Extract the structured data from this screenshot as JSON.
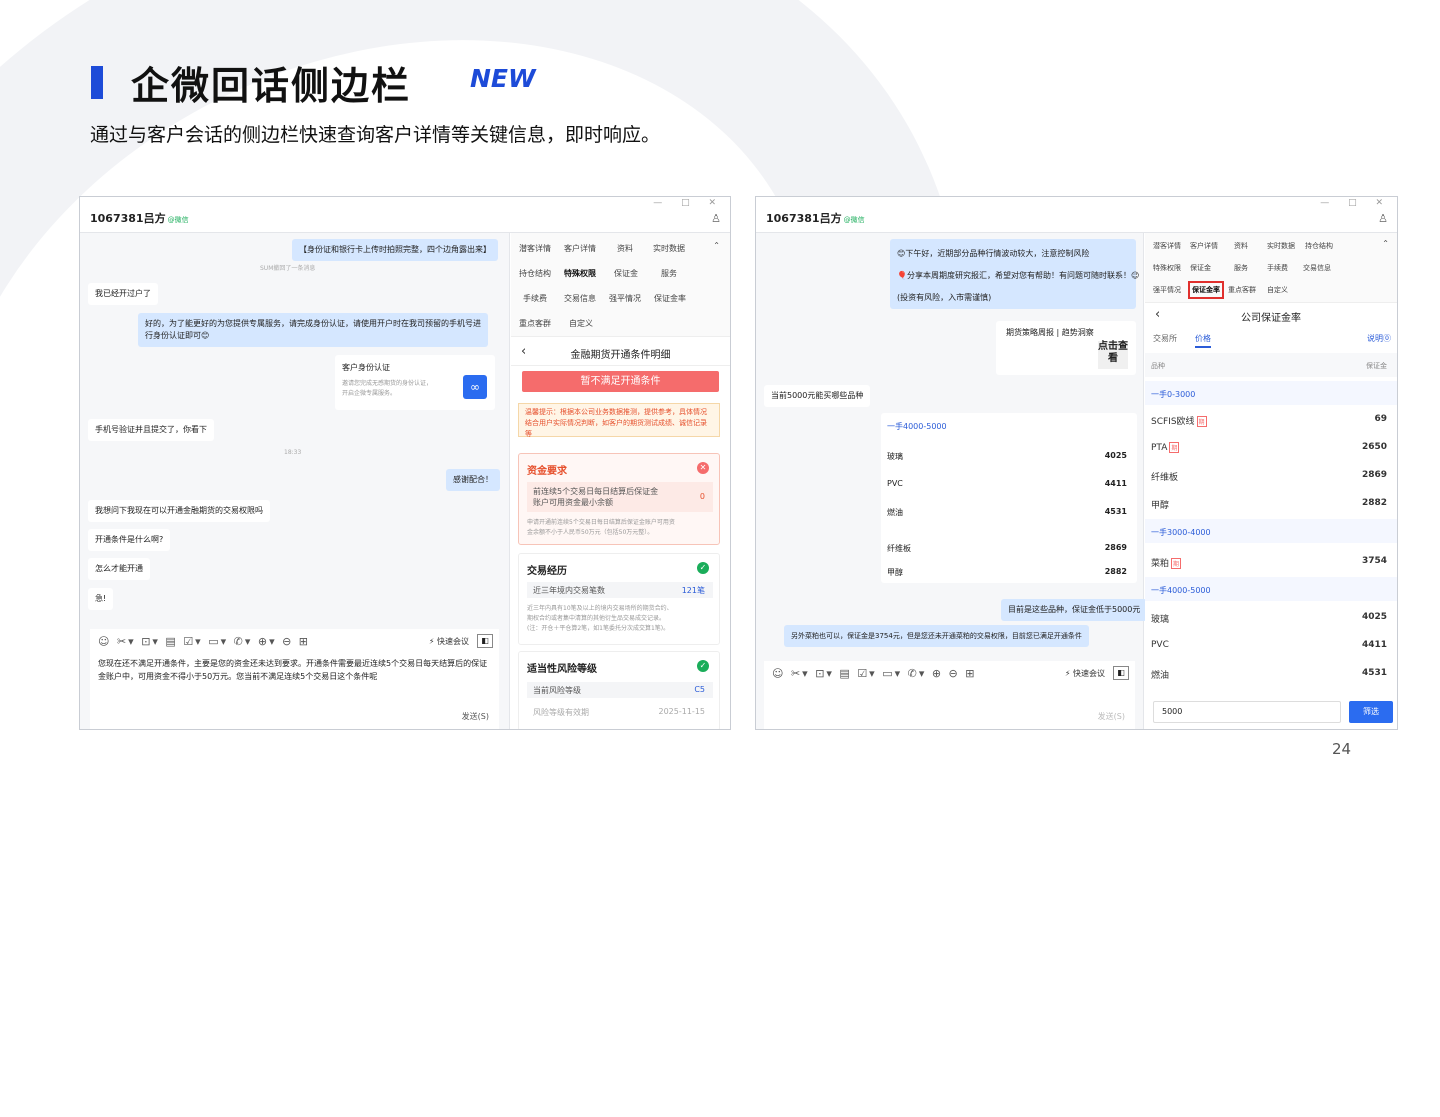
{
  "page": {
    "title": "企微回话侧边栏",
    "new_badge": "NEW",
    "subtitle": "通过与客户会话的侧边栏快速查询客户详情等关键信息，即时响应。",
    "page_number": "24"
  },
  "colors": {
    "accent": "#1d4bd8",
    "danger": "#f56c6c",
    "ok": "#1aad5a",
    "bubble": "#d5e7ff"
  },
  "window": {
    "contact_name": "1067381吕方",
    "wechat_tag": "@微信",
    "controls": "—  □  ✕",
    "user_icon": "add-user-icon"
  },
  "shot1": {
    "messages": [
      {
        "text": "【身份证和银行卡上传时拍照完整，四个边角露出来】"
      },
      {
        "text": "SUM撤回了一条消息"
      },
      {
        "text": "我已经开过户了"
      },
      {
        "text": "好的，为了能更好的为您提供专属服务，请完成身份认证，请使用开户时在我司预留的手机号进"
      },
      {
        "text": "行身份认证即可😊"
      },
      {
        "text": "手机号验证并且提交了，你看下"
      },
      {
        "text": "18:33"
      },
      {
        "text": "感谢配合！"
      },
      {
        "text": "我想问下我现在可以开通金融期货的交易权限吗"
      },
      {
        "text": "开通条件是什么啊?"
      },
      {
        "text": "怎么才能开通"
      },
      {
        "text": "急!"
      }
    ],
    "card": {
      "title": "客户身份认证",
      "desc1": "邀请您完成无感期货的身份认证，",
      "desc2": "开启企微专属服务。"
    },
    "toolbar": {
      "icons": "☺ ✂▾ ⊡▾ ▤ ☑▾ ▭▾ ✆▾ ⊕▾ ⊖ ⊞",
      "quick_meeting": "快速会议"
    },
    "draft": "您现在还不满足开通条件，主要是您的资金还未达到要求。开通条件需要最近连续5个交易日每天结算后的保证金账户中，可用资金不得小于50万元。您当前不满足连续5个交易日这个条件呢",
    "send_label": "发送(S)",
    "tabs": [
      {
        "label": "潜客详情"
      },
      {
        "label": "客户详情"
      },
      {
        "label": "资料"
      },
      {
        "label": "实时数据"
      },
      {
        "label": "持仓结构"
      },
      {
        "label": "特殊权限"
      },
      {
        "label": "保证金"
      },
      {
        "label": "服务"
      },
      {
        "label": "手续费"
      },
      {
        "label": "交易信息"
      },
      {
        "label": "强平情况"
      },
      {
        "label": "保证金率"
      },
      {
        "label": "重点客群"
      },
      {
        "label": "自定义"
      }
    ],
    "panel_title": "金融期货开通条件明细",
    "status_button": "暂不满足开通条件",
    "warm_tip": "温馨提示：根据本公司业务数据推测，提供参考，具体情况结合用户实际情况判断，如客户的期货测试成绩、诚信记录等",
    "sections": {
      "capital": {
        "title": "资金要求",
        "row_label1": "前连续5个交易日每日结算后保证金",
        "row_label2": "账户可用资金最小余额",
        "row_value": "0",
        "desc1": "申请开通前连续5个交易日每日结算后保证金账户可用资",
        "desc2": "金余额不小于人民币50万元（包括50万元整）。"
      },
      "experience": {
        "title": "交易经历",
        "row_label": "近三年境内交易笔数",
        "row_value": "121笔",
        "desc1": "近三年内具有10笔及以上的境内交易场所的期货合约、",
        "desc2": "期权合约或者集中清算的其他衍生品交易成交记录。",
        "desc3": "(注：开仓＋平仓算2笔，如1笔委托分次成交算1笔)。"
      },
      "risk": {
        "title": "适当性风险等级",
        "row1_label": "当前风险等级",
        "row1_value": "C5",
        "row2_label": "风险等级有效期",
        "row2_value": "2025-11-15"
      }
    }
  },
  "shot2": {
    "messages": [
      {
        "text": "😊下午好，近期部分品种行情波动较大，注意控制风险"
      },
      {
        "text": "🎈分享本周期度研究报汇，希望对您有帮助！有问题可随时联系！😉"
      },
      {
        "text": "(投资有风险，入市需谨慎)"
      },
      {
        "text": "期货策略周报 | 趋势洞察"
      },
      {
        "text": "点击查看"
      },
      {
        "text": "当前5000元能买哪些品种"
      },
      {
        "text": "目前是这些品种，保证金低于5000元"
      },
      {
        "text": "另外菜粕也可以，保证金是3754元，但是您还未开通菜粕的交易权限，目前您已满足开通条件"
      }
    ],
    "chat_card": {
      "group": "一手4000-5000",
      "items": [
        {
          "name": "玻璃",
          "value": "4025"
        },
        {
          "name": "PVC",
          "value": "4411"
        },
        {
          "name": "燃油",
          "value": "4531"
        },
        {
          "name": "纤维板",
          "value": "2869"
        },
        {
          "name": "甲醇",
          "value": "2882"
        }
      ]
    },
    "toolbar": {
      "icons": "☺ ✂▾ ⊡▾ ▤ ☑▾ ▭▾ ✆▾ ⊕ ⊖ ⊞",
      "quick_meeting": "快速会议"
    },
    "send_label": "发送(S)",
    "tabs": [
      {
        "label": "潜客详情"
      },
      {
        "label": "客户详情"
      },
      {
        "label": "资料"
      },
      {
        "label": "实时数据"
      },
      {
        "label": "持仓结构"
      },
      {
        "label": "特殊权限"
      },
      {
        "label": "保证金"
      },
      {
        "label": "服务"
      },
      {
        "label": "手续费"
      },
      {
        "label": "交易信息"
      },
      {
        "label": "强平情况"
      },
      {
        "label": "保证金率"
      },
      {
        "label": "重点客群"
      },
      {
        "label": "自定义"
      }
    ],
    "panel_title": "公司保证金率",
    "subtabs": [
      {
        "label": "交易所"
      },
      {
        "label": "价格"
      }
    ],
    "help": "说明⓪",
    "col_variety": "品种",
    "col_margin": "保证金",
    "groups": [
      {
        "label": "一手0-3000",
        "items": [
          {
            "name": "SCFIS欧线",
            "tag": "期",
            "value": "69"
          },
          {
            "name": "PTA",
            "tag": "期",
            "value": "2650"
          },
          {
            "name": "纤维板",
            "tag": "",
            "value": "2869"
          },
          {
            "name": "甲醇",
            "tag": "",
            "value": "2882"
          }
        ]
      },
      {
        "label": "一手3000-4000",
        "items": [
          {
            "name": "菜粕",
            "tag": "期",
            "value": "3754"
          }
        ]
      },
      {
        "label": "一手4000-5000",
        "items": [
          {
            "name": "玻璃",
            "tag": "",
            "value": "4025"
          },
          {
            "name": "PVC",
            "tag": "",
            "value": "4411"
          },
          {
            "name": "燃油",
            "tag": "",
            "value": "4531"
          }
        ]
      }
    ],
    "search_value": "5000",
    "filter_button": "筛选"
  }
}
